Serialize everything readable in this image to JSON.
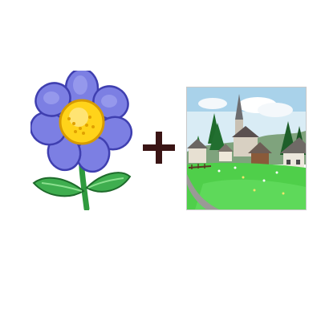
{
  "scene": {
    "background": "#ffffff",
    "items": [
      {
        "kind": "illustration",
        "icon": "blue-flower-icon",
        "colors": {
          "petal": "#7c7fe3",
          "petal_edge": "#3f3fb0",
          "center": "#ffd31a",
          "leaf": "#3fae4f",
          "stem": "#2f9a3e"
        }
      },
      {
        "kind": "symbol",
        "icon": "plus-icon",
        "color": "#3a1414"
      },
      {
        "kind": "painting",
        "icon": "village-painting-icon",
        "colors": {
          "sky": "#cfe6f2",
          "grass": "#4fcf4a",
          "trees": "#1f6b2c",
          "road": "#9a9a96"
        }
      }
    ]
  }
}
